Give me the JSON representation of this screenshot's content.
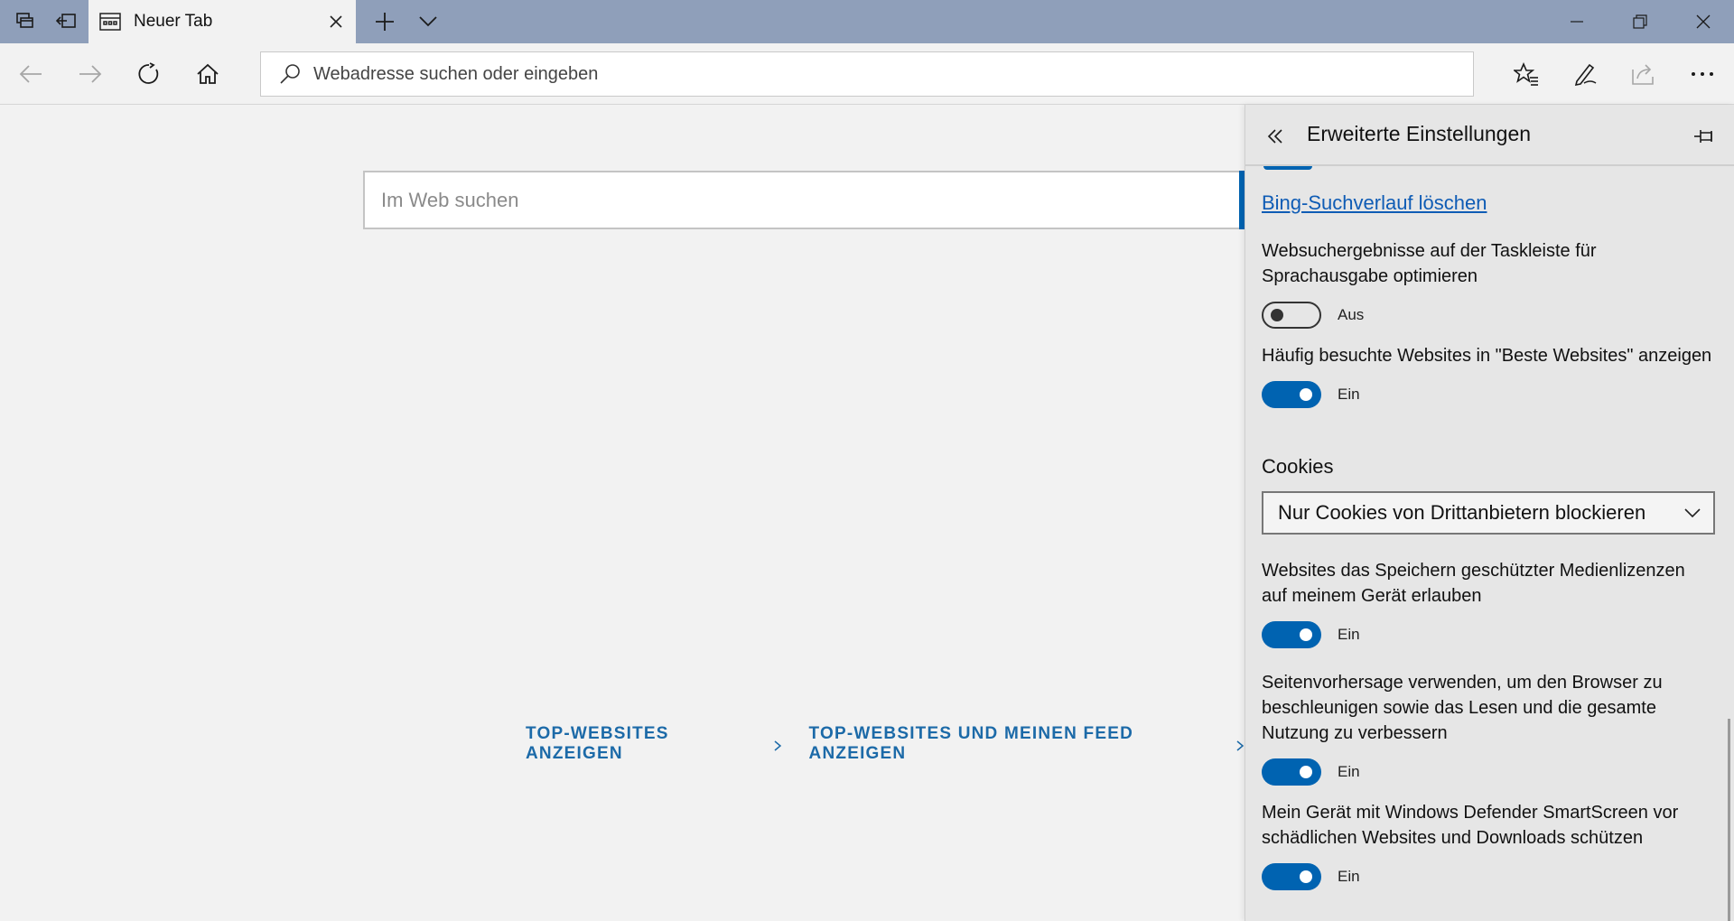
{
  "titlebar": {
    "tab": {
      "title": "Neuer Tab",
      "favicon": "newtab-page-icon"
    },
    "icons": [
      "tab-sets-icon",
      "restore-tabs-icon",
      "new-tab-plus-icon",
      "tab-preview-chevron-icon"
    ],
    "window_controls": [
      "minimize-icon",
      "maximize-icon",
      "close-icon"
    ],
    "color": "#8f9fba"
  },
  "navbar": {
    "address_placeholder": "Webadresse suchen oder eingeben",
    "icons": [
      "back-icon",
      "forward-icon",
      "refresh-icon",
      "home-icon",
      "favorites-star-icon",
      "pen-notes-icon",
      "share-icon",
      "more-icon"
    ]
  },
  "content": {
    "search_placeholder": "Im Web suchen",
    "link_top_sites": "TOP-WEBSITES ANZEIGEN",
    "link_top_sites_feed": "TOP-WEBSITES UND MEINEN FEED ANZEIGEN",
    "accent_color": "#0063b1"
  },
  "panel": {
    "title": "Erweiterte Einstellungen",
    "bing_link": "Bing-Suchverlauf löschen",
    "settings": [
      {
        "label": "Websuchergebnisse auf der Taskleiste für Sprachausgabe optimieren",
        "state": "Aus",
        "on": false
      },
      {
        "label": "Häufig besuchte Websites in \"Beste Websites\" anzeigen",
        "state": "Ein",
        "on": true
      },
      {
        "label": "Websites das Speichern geschützter Medienlizenzen auf meinem Gerät erlauben",
        "state": "Ein",
        "on": true
      },
      {
        "label": "Seitenvorhersage verwenden, um den Browser zu beschleunigen sowie das Lesen und die gesamte Nutzung zu verbessern",
        "state": "Ein",
        "on": true
      },
      {
        "label": "Mein Gerät mit Windows Defender SmartScreen vor schädlichen Websites und Downloads schützen",
        "state": "Ein",
        "on": true
      }
    ],
    "cookies": {
      "title": "Cookies",
      "selected": "Nur Cookies von Drittanbietern blockieren"
    }
  }
}
